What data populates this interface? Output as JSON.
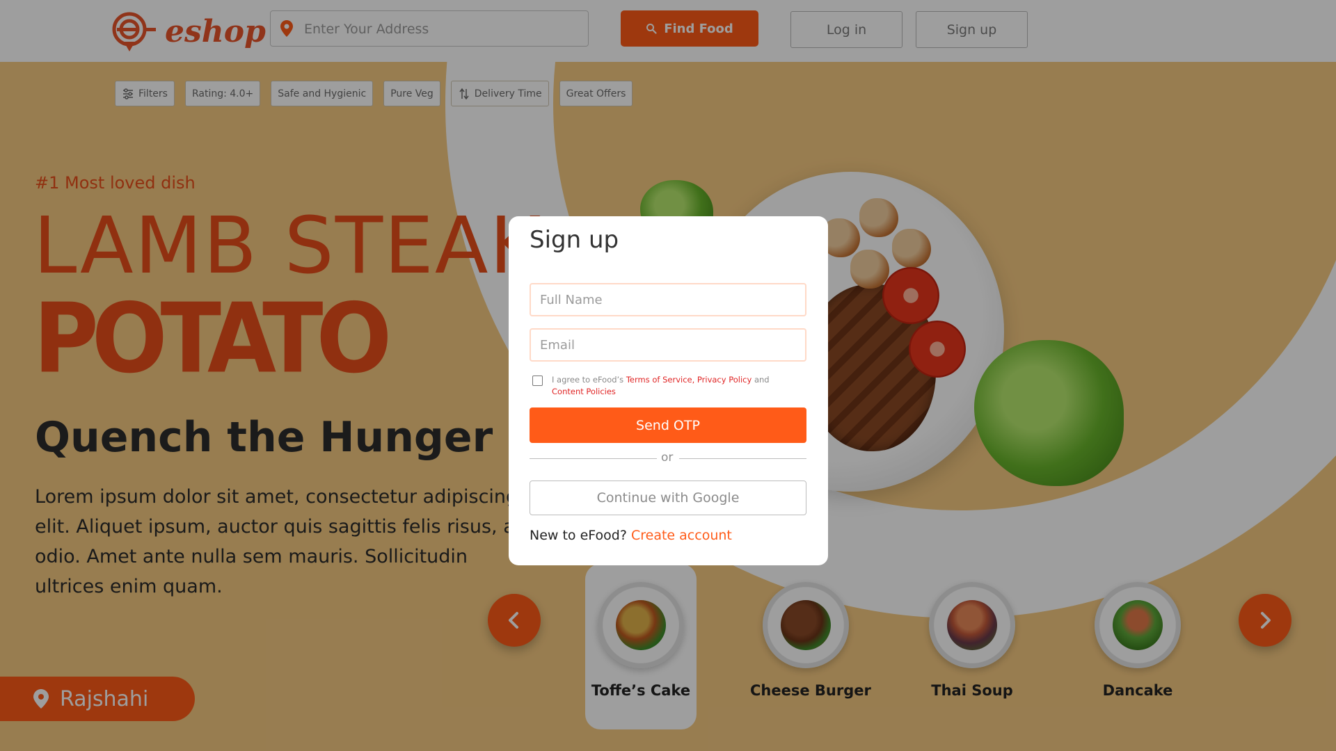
{
  "header": {
    "logo_text": "eshop",
    "address_placeholder": "Enter Your Address",
    "find_food_label": "Find Food",
    "login_label": "Log in",
    "signup_label": "Sign up"
  },
  "filters": [
    {
      "label": "Filters",
      "icon": "sliders-icon"
    },
    {
      "label": "Rating: 4.0+"
    },
    {
      "label": "Safe and Hygienic"
    },
    {
      "label": "Pure Veg"
    },
    {
      "label": "Delivery Time",
      "icon": "sort-arrows-icon"
    },
    {
      "label": "Great Offers"
    }
  ],
  "hero": {
    "tagline": "#1 Most loved dish",
    "title_line1": "LAMB STEAK",
    "title_line2": "POTATO",
    "subtitle": "Quench the Hunger",
    "description": "Lorem ipsum dolor sit amet, consectetur adipiscing elit. Aliquet ipsum, auctor quis sagittis felis risus, a odio. Amet ante nulla sem mauris. Sollicitudin ultrices enim quam."
  },
  "location": {
    "label": "Rajshahi"
  },
  "dishes": [
    {
      "name": "Toffe’s Cake",
      "active": true
    },
    {
      "name": "Cheese Burger"
    },
    {
      "name": "Thai  Soup"
    },
    {
      "name": "Dancake"
    }
  ],
  "modal": {
    "title": "Sign up",
    "full_name_placeholder": "Full Name",
    "email_placeholder": "Email",
    "agree_prefix": "I agree to eFood’s ",
    "terms_link": "Terms of Service, Privacy Policy",
    "agree_and": " and ",
    "content_link": "Content Policies",
    "send_otp_label": "Send OTP",
    "or_label": "or",
    "google_label": "Continue with Google",
    "new_to_text": "New to eFood? ",
    "create_account_label": "Create account"
  },
  "colors": {
    "accent": "#ff5b18",
    "hero_bg": "#f6ca82",
    "title": "#e84e1b"
  }
}
